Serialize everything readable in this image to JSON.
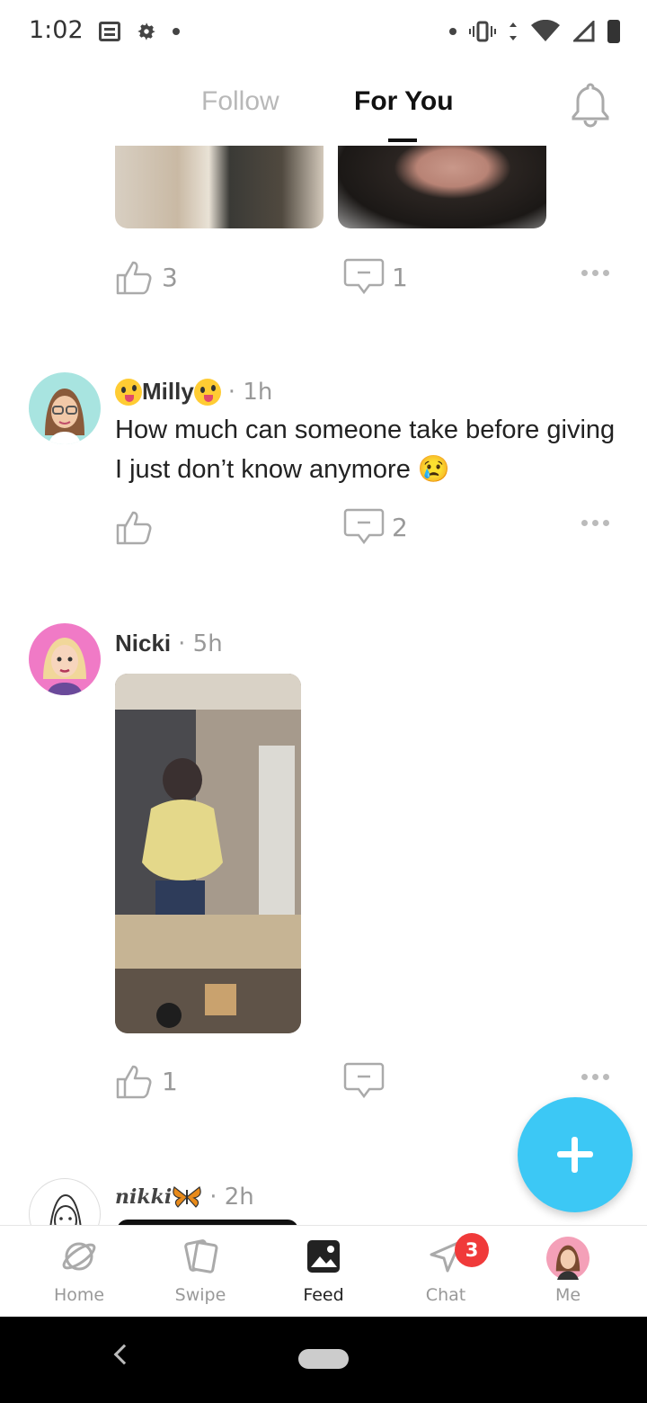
{
  "status_bar": {
    "time": "1:02"
  },
  "tabs": {
    "follow": "Follow",
    "for_you": "For You"
  },
  "posts": [
    {
      "likes": "3",
      "comments": "1"
    },
    {
      "name": "Milly",
      "time": "· 1h",
      "text": "How much can someone take before giving I just don’t know anymore",
      "emoji_end": "😢",
      "likes": "",
      "comments": "2"
    },
    {
      "name": "Nicki",
      "time": "· 5h",
      "likes": "1",
      "comments": ""
    },
    {
      "name": "nikki",
      "time": "· 2h"
    }
  ],
  "bottom_nav": {
    "items": [
      {
        "label": "Home",
        "icon": "planet-icon"
      },
      {
        "label": "Swipe",
        "icon": "cards-icon"
      },
      {
        "label": "Feed",
        "icon": "image-icon",
        "active": true
      },
      {
        "label": "Chat",
        "icon": "send-icon",
        "badge": "3"
      },
      {
        "label": "Me",
        "icon": "avatar"
      }
    ]
  },
  "colors": {
    "accent": "#3cc8f5",
    "badge": "#f03a3a"
  }
}
